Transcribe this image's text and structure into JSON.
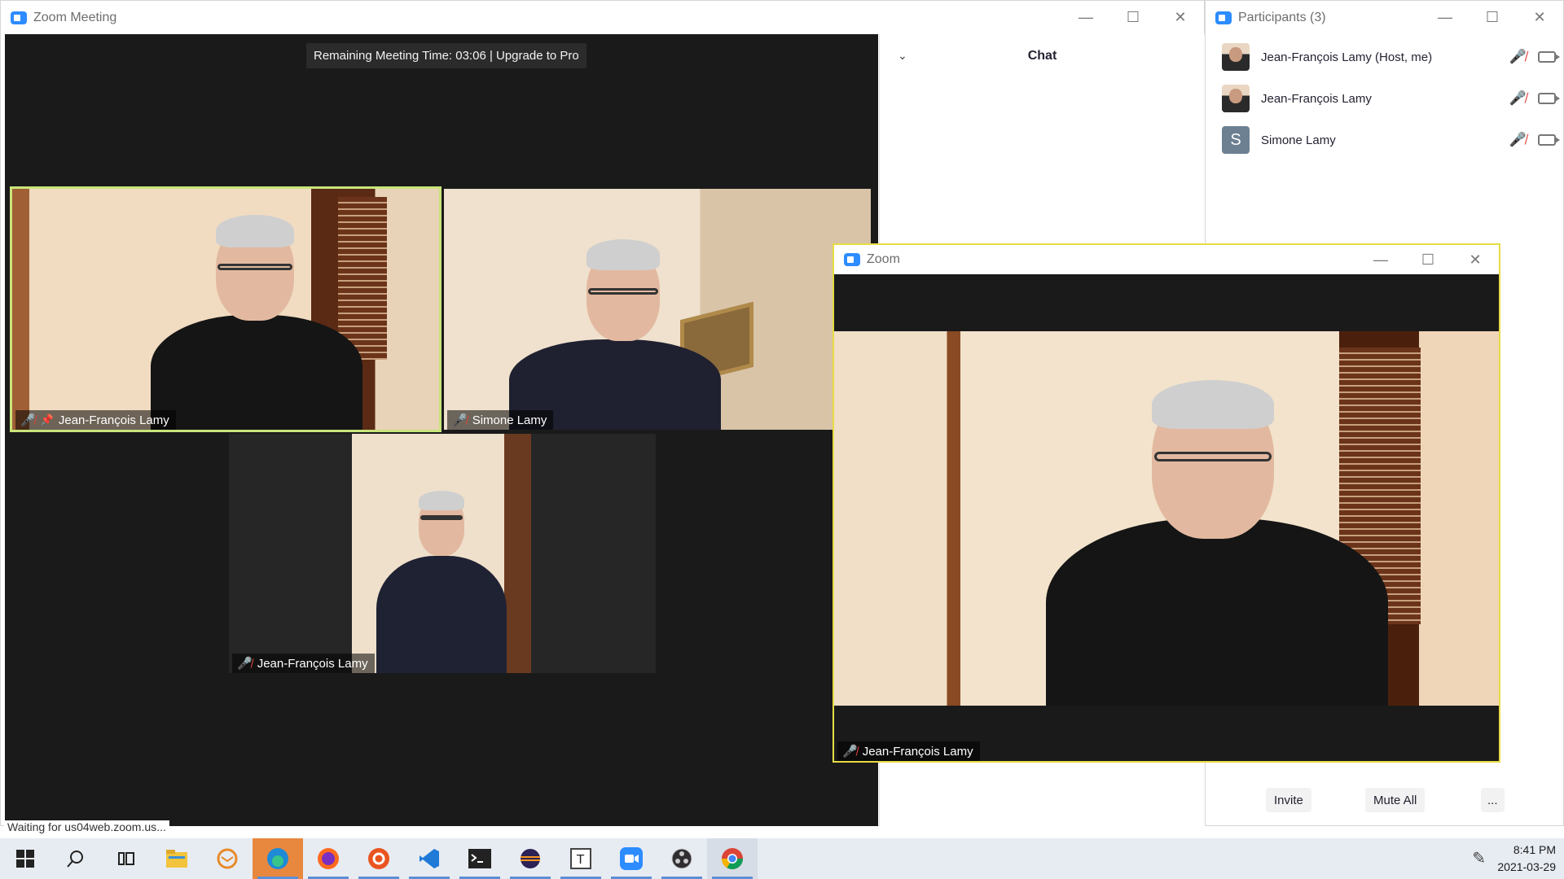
{
  "main_window": {
    "title": "Zoom Meeting",
    "remaining_time": "Remaining Meeting Time: 03:06 | Upgrade to Pro",
    "tiles": [
      {
        "name": "Jean-François Lamy",
        "muted": true,
        "pinned": true,
        "active_speaker": true
      },
      {
        "name": "Simone Lamy",
        "muted": true
      },
      {
        "name": "Jean-François Lamy",
        "muted": true
      }
    ]
  },
  "chat": {
    "title": "Chat",
    "collapse_glyph": "⌄"
  },
  "participants_window": {
    "title": "Participants (3)",
    "list": [
      {
        "name": "Jean-François Lamy (Host, me)",
        "avatar": "photo"
      },
      {
        "name": "Jean-François Lamy",
        "avatar": "photo"
      },
      {
        "name": "Simone Lamy",
        "avatar": "letter",
        "initial": "S"
      }
    ],
    "buttons": {
      "invite": "Invite",
      "mute_all": "Mute All",
      "more": "..."
    }
  },
  "zoom_float": {
    "title": "Zoom",
    "nametag": "Jean-François Lamy"
  },
  "window_controls": {
    "minimize": "—",
    "maximize": "☐",
    "close": "✕"
  },
  "status": "Waiting for us04web.zoom.us...",
  "taskbar": {
    "icons": [
      "windows-start-icon",
      "search-icon",
      "task-view-icon",
      "file-explorer-icon",
      "thunderbird-icon",
      "edge-icon",
      "firefox-icon",
      "ubuntu-icon",
      "vscode-icon",
      "terminal-icon",
      "eclipse-icon",
      "typora-icon",
      "zoom-icon",
      "obs-icon",
      "chrome-icon"
    ],
    "time": "8:41 PM",
    "date": "2021-03-29"
  },
  "colors": {
    "active_speaker_border": "#c9e47a",
    "float_border": "#e6dc45",
    "zoom_blue": "#2d8cff",
    "mute_red": "#e0433b"
  }
}
